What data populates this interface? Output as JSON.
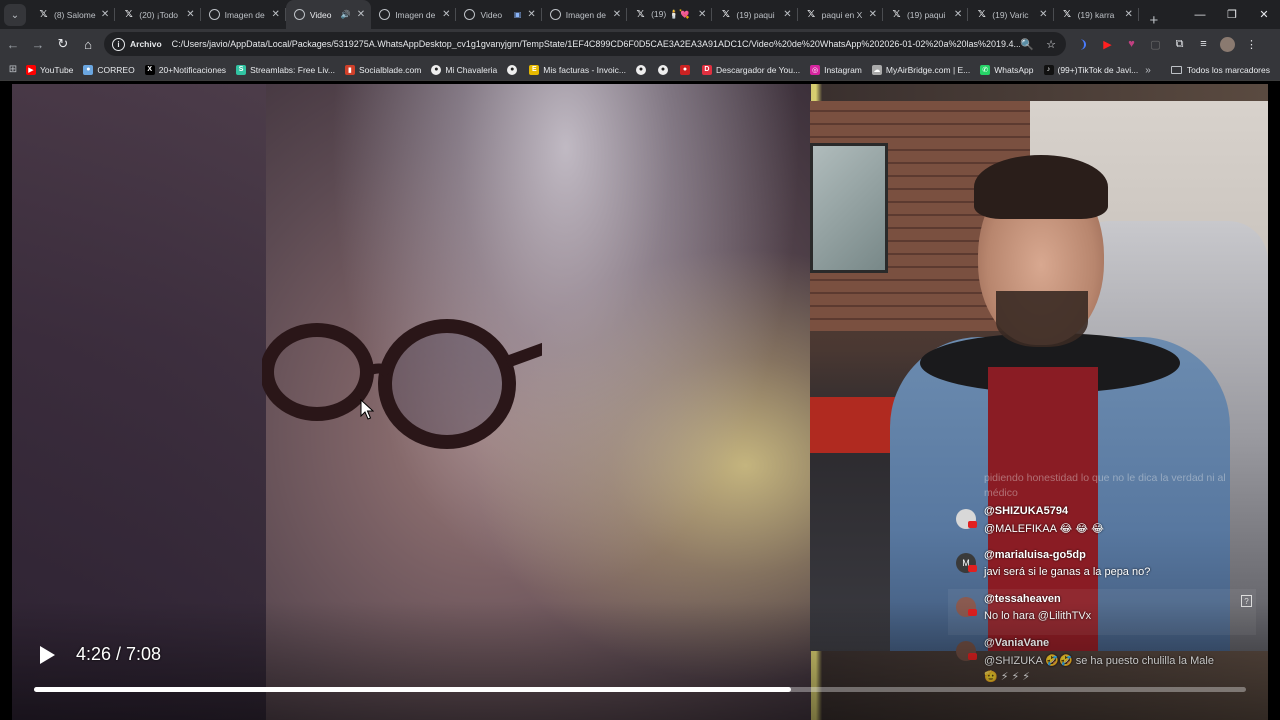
{
  "tabstrip": {
    "tabs": [
      {
        "label": "(8) Salome",
        "favicon": "x-icon",
        "active": false
      },
      {
        "label": "(20) ¡Todo",
        "favicon": "x-icon",
        "active": false
      },
      {
        "label": "Imagen de",
        "favicon": "globe-icon",
        "active": false
      },
      {
        "label": "Video",
        "favicon": "globe-icon",
        "active": true,
        "audio": true
      },
      {
        "label": "Imagen de",
        "favicon": "globe-icon",
        "active": false
      },
      {
        "label": "Video",
        "favicon": "globe-icon",
        "active": false,
        "media": true
      },
      {
        "label": "Imagen de",
        "favicon": "globe-icon",
        "active": false
      },
      {
        "label": "(19) 🕯️💘",
        "favicon": "x-icon",
        "active": false
      },
      {
        "label": "(19) paqui",
        "favicon": "x-icon",
        "active": false
      },
      {
        "label": "paqui en X",
        "favicon": "x-icon",
        "active": false
      },
      {
        "label": "(19) paqui",
        "favicon": "x-icon",
        "active": false
      },
      {
        "label": "(19) Varic",
        "favicon": "x-icon",
        "active": false
      },
      {
        "label": "(19) karra",
        "favicon": "x-icon",
        "active": false
      }
    ],
    "new_tab": "+",
    "window_controls": {
      "minimize": "—",
      "restore": "❐",
      "close": "✕"
    }
  },
  "toolbar": {
    "back": "←",
    "forward": "→",
    "reload": "↻",
    "home": "⌂",
    "chip": "Archivo",
    "url": "C:/Users/javio/AppData/Local/Packages/5319275A.WhatsAppDesktop_cv1g1gvanyjgm/TempState/1EF4C899CD6F0D5CAE3A2EA3A91ADC1C/Video%20de%20WhatsApp%202026-01-02%20a%20las%2019.4...",
    "zoom_icon": "🔍",
    "star_icon": "☆"
  },
  "bookmarks": {
    "items": [
      {
        "label": "YouTube",
        "color": "#ff0000",
        "glyph": "▶"
      },
      {
        "label": "CORREO",
        "color": "#6aa6e0",
        "glyph": "●"
      },
      {
        "label": "20+Notificaciones",
        "color": "#000000",
        "glyph": "X"
      },
      {
        "label": "Streamlabs: Free Liv...",
        "color": "#31c3a2",
        "glyph": "S"
      },
      {
        "label": "Socialblade.com",
        "color": "#d0402a",
        "glyph": "▮"
      },
      {
        "label": "Mi Chavaleria",
        "color": "#eeeeee",
        "glyph": "●"
      },
      {
        "label": "",
        "color": "#eeeeee",
        "glyph": "●"
      },
      {
        "label": "Mis facturas - Invoic...",
        "color": "#e6b800",
        "glyph": "E"
      },
      {
        "label": "",
        "color": "#eeeeee",
        "glyph": "●"
      },
      {
        "label": "",
        "color": "#eeeeee",
        "glyph": "●"
      },
      {
        "label": "",
        "color": "#cc2222",
        "glyph": "●"
      },
      {
        "label": "Descargador de You...",
        "color": "#e03040",
        "glyph": "D"
      },
      {
        "label": "Instagram",
        "color": "#d6249f",
        "glyph": "◎"
      },
      {
        "label": "MyAirBridge.com | E...",
        "color": "#aaaaaa",
        "glyph": "☁"
      },
      {
        "label": "WhatsApp",
        "color": "#25d366",
        "glyph": "✆"
      },
      {
        "label": "(99+)TikTok de Javi...",
        "color": "#111111",
        "glyph": "♪"
      }
    ],
    "more": "»",
    "all_bookmarks": "Todos los marcadores"
  },
  "chat": {
    "faded_text": "pidiendo honestidad lo que no le dica la verdad ni al médico",
    "messages": [
      {
        "user": "@SHIZUKA5794",
        "text": "@MALEFIKAA 😂 😂 😂",
        "avatar": "",
        "avatar_color": "#d8d8d8"
      },
      {
        "user": "@marialuisa-go5dp",
        "text": "javi será si le ganas a la pepa no?",
        "avatar": "M",
        "avatar_color": "#3a3a3a"
      },
      {
        "user": "@tessaheaven",
        "text": "No lo hara @LilithTVx",
        "avatar": "",
        "avatar_color": "#8a5a50"
      },
      {
        "user": "@VaniaVane",
        "text": "@SHIZUKA 🤣🤣 se ha puesto chulilla la Male",
        "text2": "🫡 ⚡ ⚡ ⚡",
        "avatar": "",
        "avatar_color": "#6a4a40"
      }
    ]
  },
  "player": {
    "time_display": "4:26 / 7:08",
    "progress_fraction": 0.6245
  }
}
